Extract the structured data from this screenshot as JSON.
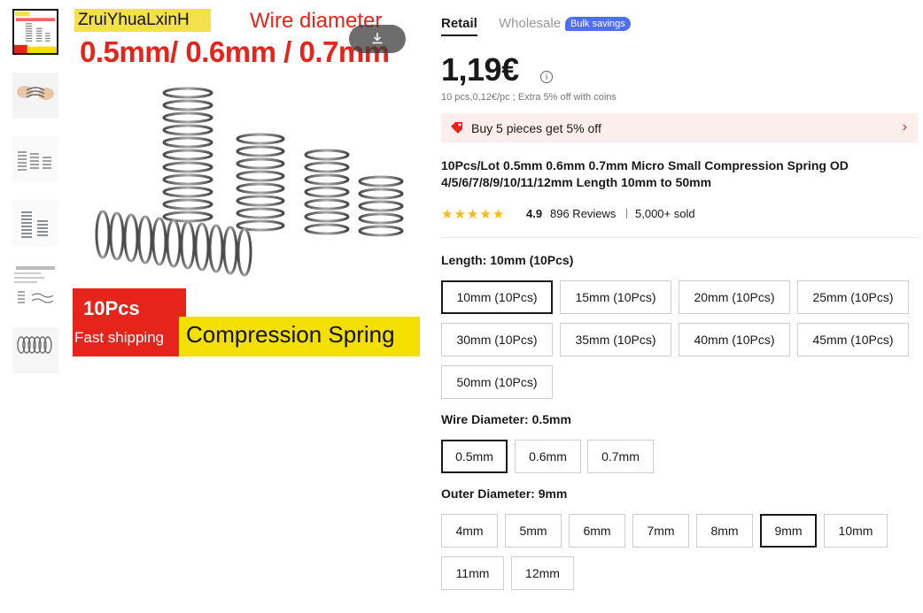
{
  "image": {
    "brand": "ZruiYhuaLxinH",
    "wire_title": "Wire diameter",
    "wire_sizes": "0.5mm/ 0.6mm / 0.7mm",
    "banner_count": "10Pcs",
    "banner_shipping": "Fast shipping",
    "banner_product": "Compression Spring",
    "download_icon": "download-icon"
  },
  "tabs": {
    "retail": "Retail",
    "wholesale": "Wholesale",
    "bulk_badge": "Bulk savings"
  },
  "price": {
    "value": "1,19€",
    "info_icon": "i",
    "sub": "10 pcs,0,12€/pc ; Extra 5% off with coins"
  },
  "promo": {
    "text": "Buy 5 pieces get 5% off",
    "chevron": "›",
    "accent": "#e5251c"
  },
  "product": {
    "title": "10Pcs/Lot 0.5mm 0.6mm 0.7mm Micro Small Compression Spring OD 4/5/6/7/8/9/10/11/12mm Length 10mm to 50mm"
  },
  "rating": {
    "stars": "★★★★★",
    "value": "4.9",
    "reviews": "896 Reviews",
    "sold": "5,000+ sold"
  },
  "length": {
    "label": "Length: 10mm (10Pcs)",
    "options": [
      "10mm (10Pcs)",
      "15mm (10Pcs)",
      "20mm (10Pcs)",
      "25mm (10Pcs)",
      "30mm (10Pcs)",
      "35mm (10Pcs)",
      "40mm (10Pcs)",
      "45mm (10Pcs)",
      "50mm (10Pcs)"
    ],
    "selected": "10mm (10Pcs)"
  },
  "wire": {
    "label": "Wire Diameter: 0.5mm",
    "options": [
      "0.5mm",
      "0.6mm",
      "0.7mm"
    ],
    "selected": "0.5mm"
  },
  "outer": {
    "label": "Outer Diameter: 9mm",
    "options": [
      "4mm",
      "5mm",
      "6mm",
      "7mm",
      "8mm",
      "9mm",
      "10mm",
      "11mm",
      "12mm"
    ],
    "selected": "9mm"
  }
}
